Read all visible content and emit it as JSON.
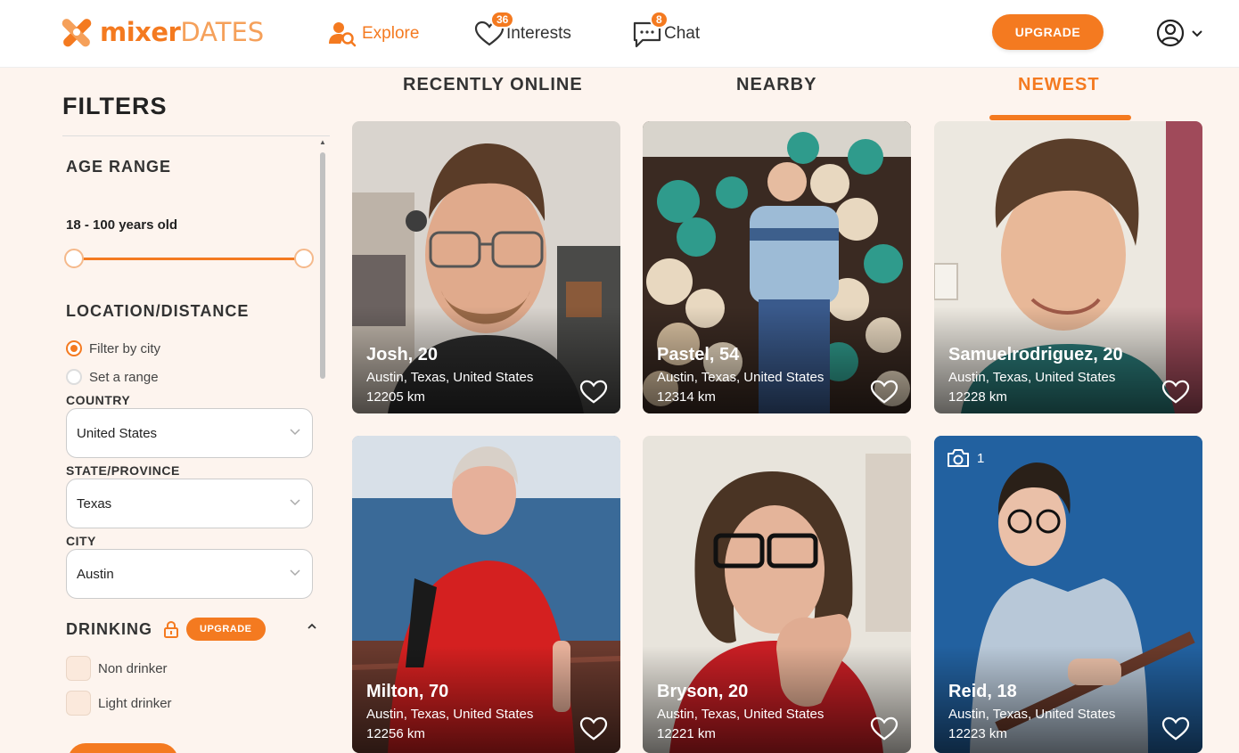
{
  "brand": {
    "part1": "mixer",
    "part2": "DATES",
    "accent": "#f47a20"
  },
  "nav": {
    "explore": {
      "label": "Explore",
      "icon": "user-search-icon"
    },
    "interests": {
      "label": "Interests",
      "badge": "36",
      "icon": "heart-icon"
    },
    "chat": {
      "label": "Chat",
      "badge": "8",
      "icon": "chat-bubble-icon"
    },
    "upgrade": "UPGRADE",
    "account_icon": "user-circle-icon"
  },
  "filters": {
    "title": "FILTERS",
    "age": {
      "label": "AGE RANGE",
      "value": "18 - 100 years old",
      "min": 18,
      "max": 100
    },
    "location": {
      "label": "LOCATION/DISTANCE",
      "options": [
        "Filter by city",
        "Set a range"
      ],
      "selected": "Filter by city",
      "country_label": "COUNTRY",
      "country": "United States",
      "state_label": "STATE/PROVINCE",
      "state": "Texas",
      "city_label": "CITY",
      "city": "Austin"
    },
    "drinking": {
      "label": "DRINKING",
      "upgrade": "UPGRADE",
      "options": [
        "Non drinker",
        "Light drinker"
      ]
    }
  },
  "tabs": [
    "RECENTLY ONLINE",
    "NEARBY",
    "NEWEST"
  ],
  "active_tab": "NEWEST",
  "profiles": [
    {
      "name": "Josh, 20",
      "location": "Austin, Texas, United States",
      "distance": "12205 km"
    },
    {
      "name": "Pastel, 54",
      "location": "Austin, Texas, United States",
      "distance": "12314 km"
    },
    {
      "name": "Samuelrodriguez, 20",
      "location": "Austin, Texas, United States",
      "distance": "12228 km"
    },
    {
      "name": "Milton, 70",
      "location": "Austin, Texas, United States",
      "distance": "12256 km"
    },
    {
      "name": "Bryson, 20",
      "location": "Austin, Texas, United States",
      "distance": "12221 km"
    },
    {
      "name": "Reid, 18",
      "location": "Austin, Texas, United States",
      "distance": "12223 km",
      "photo_count": "1"
    }
  ]
}
